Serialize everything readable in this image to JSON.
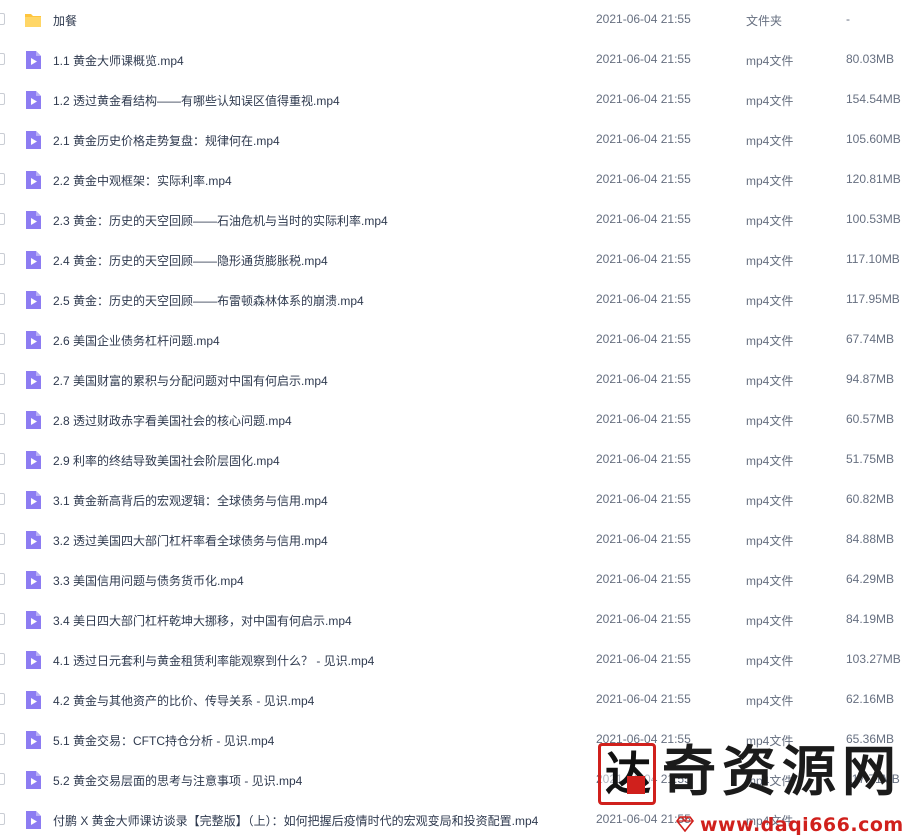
{
  "files": [
    {
      "name": "加餐",
      "date": "2021-06-04 21:55",
      "type": "文件夹",
      "size": "-",
      "icon": "folder-icon"
    },
    {
      "name": "1.1 黄金大师课概览.mp4",
      "date": "2021-06-04 21:55",
      "type": "mp4文件",
      "size": "80.03MB",
      "icon": "video-file-icon"
    },
    {
      "name": "1.2 透过黄金看结构——有哪些认知误区值得重视.mp4",
      "date": "2021-06-04 21:55",
      "type": "mp4文件",
      "size": "154.54MB",
      "icon": "video-file-icon"
    },
    {
      "name": "2.1 黄金历史价格走势复盘：规律何在.mp4",
      "date": "2021-06-04 21:55",
      "type": "mp4文件",
      "size": "105.60MB",
      "icon": "video-file-icon"
    },
    {
      "name": "2.2 黄金中观框架：实际利率.mp4",
      "date": "2021-06-04 21:55",
      "type": "mp4文件",
      "size": "120.81MB",
      "icon": "video-file-icon"
    },
    {
      "name": "2.3 黄金：历史的天空回顾——石油危机与当时的实际利率.mp4",
      "date": "2021-06-04 21:55",
      "type": "mp4文件",
      "size": "100.53MB",
      "icon": "video-file-icon"
    },
    {
      "name": "2.4 黄金：历史的天空回顾——隐形通货膨胀税.mp4",
      "date": "2021-06-04 21:55",
      "type": "mp4文件",
      "size": "117.10MB",
      "icon": "video-file-icon"
    },
    {
      "name": "2.5 黄金：历史的天空回顾——布雷顿森林体系的崩溃.mp4",
      "date": "2021-06-04 21:55",
      "type": "mp4文件",
      "size": "117.95MB",
      "icon": "video-file-icon"
    },
    {
      "name": "2.6 美国企业债务杠杆问题.mp4",
      "date": "2021-06-04 21:55",
      "type": "mp4文件",
      "size": "67.74MB",
      "icon": "video-file-icon"
    },
    {
      "name": "2.7 美国财富的累积与分配问题对中国有何启示.mp4",
      "date": "2021-06-04 21:55",
      "type": "mp4文件",
      "size": "94.87MB",
      "icon": "video-file-icon"
    },
    {
      "name": "2.8 透过财政赤字看美国社会的核心问题.mp4",
      "date": "2021-06-04 21:55",
      "type": "mp4文件",
      "size": "60.57MB",
      "icon": "video-file-icon"
    },
    {
      "name": "2.9 利率的终结导致美国社会阶层固化.mp4",
      "date": "2021-06-04 21:55",
      "type": "mp4文件",
      "size": "51.75MB",
      "icon": "video-file-icon"
    },
    {
      "name": "3.1 黄金新高背后的宏观逻辑：全球债务与信用.mp4",
      "date": "2021-06-04 21:55",
      "type": "mp4文件",
      "size": "60.82MB",
      "icon": "video-file-icon"
    },
    {
      "name": "3.2 透过美国四大部门杠杆率看全球债务与信用.mp4",
      "date": "2021-06-04 21:55",
      "type": "mp4文件",
      "size": "84.88MB",
      "icon": "video-file-icon"
    },
    {
      "name": "3.3 美国信用问题与债务货币化.mp4",
      "date": "2021-06-04 21:55",
      "type": "mp4文件",
      "size": "64.29MB",
      "icon": "video-file-icon"
    },
    {
      "name": "3.4 美日四大部门杠杆乾坤大挪移，对中国有何启示.mp4",
      "date": "2021-06-04 21:55",
      "type": "mp4文件",
      "size": "84.19MB",
      "icon": "video-file-icon"
    },
    {
      "name": "4.1 透过日元套利与黄金租赁利率能观察到什么？ - 见识.mp4",
      "date": "2021-06-04 21:55",
      "type": "mp4文件",
      "size": "103.27MB",
      "icon": "video-file-icon"
    },
    {
      "name": "4.2 黄金与其他资产的比价、传导关系 - 见识.mp4",
      "date": "2021-06-04 21:55",
      "type": "mp4文件",
      "size": "62.16MB",
      "icon": "video-file-icon"
    },
    {
      "name": "5.1 黄金交易：CFTC持仓分析 - 见识.mp4",
      "date": "2021-06-04 21:55",
      "type": "mp4文件",
      "size": "65.36MB",
      "icon": "video-file-icon"
    },
    {
      "name": "5.2 黄金交易层面的思考与注意事项 - 见识.mp4",
      "date": "2021-06-04 21:55",
      "type": "mp4文件",
      "size": "117.71MB",
      "icon": "video-file-icon"
    },
    {
      "name": "付鹏 X 黄金大师课访谈录【完整版】（上）：如何把握后疫情时代的宏观变局和投资配置.mp4",
      "date": "2021-06-04 21:55",
      "type": "mp4文件",
      "size": "",
      "icon": "video-file-icon"
    }
  ],
  "watermark": {
    "seal_char": "达",
    "brand": "奇资源网",
    "url": "www.daqi666.com",
    "color": "#d0201c"
  },
  "colors": {
    "folder": "#ffc53d",
    "video_icon": "#8c7cf2"
  }
}
